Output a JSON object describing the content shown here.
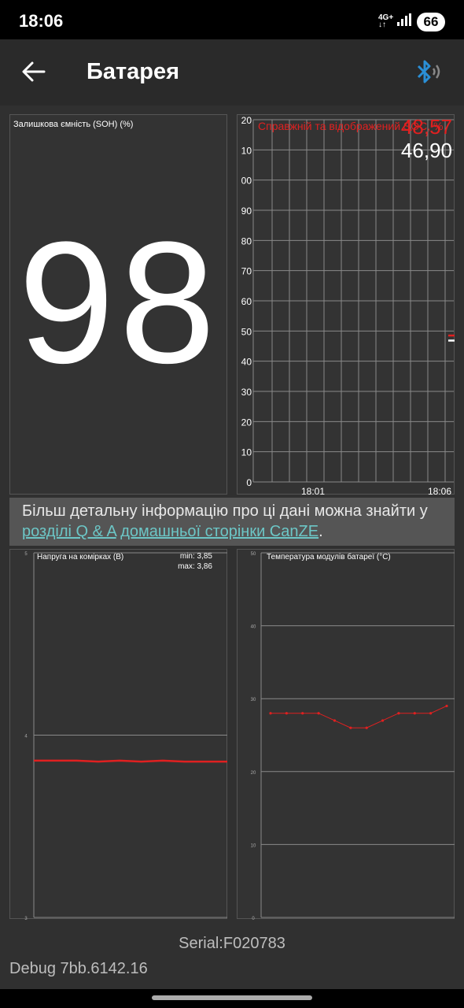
{
  "status": {
    "time": "18:06",
    "network": "4G+",
    "battery": "66"
  },
  "appbar": {
    "title": "Батарея",
    "back_icon": "arrow-left-icon",
    "bluetooth_icon": "bluetooth-audio-icon"
  },
  "soh": {
    "label": "Залишкова ємність (SOH) (%)",
    "value": "98"
  },
  "capacity_graph": {
    "title": "Справжній та відображений SOC, %",
    "value_red": "48,57",
    "value_white": "46,90",
    "accent_red": "#e02020"
  },
  "info": {
    "text_before": "Більш детальну інформацію про ці дані можна знайти у ",
    "link1": "розділі Q & A",
    "text_between": " ",
    "link2": "домашньої сторінки CanZE",
    "text_after": "."
  },
  "cells": {
    "title": "Напруга на комірках (В)",
    "min": "min: 3,85",
    "max": "max: 3,86"
  },
  "temps": {
    "title": "Температура модулів батареї (°C)"
  },
  "footer": {
    "serial": "Serial:F020783",
    "debug": "Debug 7bb.6142.16"
  },
  "chart_data": [
    {
      "type": "line",
      "title": "Справжній та відображений SOC, %",
      "xlabel": "",
      "ylabel": "",
      "ylim": [
        0,
        120
      ],
      "yticks": [
        "0",
        "10",
        "20",
        "30",
        "40",
        "50",
        "60",
        "70",
        "80",
        "90",
        "00",
        "10",
        "20"
      ],
      "xticks": [
        "18:01",
        "18:06"
      ],
      "grid": true,
      "series": [
        {
          "name": "",
          "color": "#e02020",
          "x": [
            "18:06"
          ],
          "values": [
            48.57
          ]
        },
        {
          "name": "",
          "color": "#ffffff",
          "x": [
            "18:06"
          ],
          "values": [
            46.9
          ]
        }
      ]
    },
    {
      "type": "line",
      "title": "Напруга на комірках (В)",
      "ylim": [
        3,
        5
      ],
      "yticks": [
        "3",
        "4",
        "5"
      ],
      "grid": true,
      "series": [
        {
          "name": "",
          "color": "#e02020",
          "values": [
            3.86,
            3.86,
            3.86,
            3.855,
            3.86,
            3.855,
            3.86,
            3.855,
            3.855,
            3.855
          ]
        }
      ]
    },
    {
      "type": "line",
      "title": "Температура модулів батареї (°C)",
      "ylim": [
        0,
        50
      ],
      "yticks": [
        "0",
        "10",
        "20",
        "30",
        "40",
        "50"
      ],
      "grid": true,
      "series": [
        {
          "name": "",
          "color": "#e02020",
          "values": [
            28,
            28,
            28,
            28,
            27,
            26,
            26,
            27,
            28,
            28,
            28,
            29
          ]
        }
      ]
    }
  ]
}
